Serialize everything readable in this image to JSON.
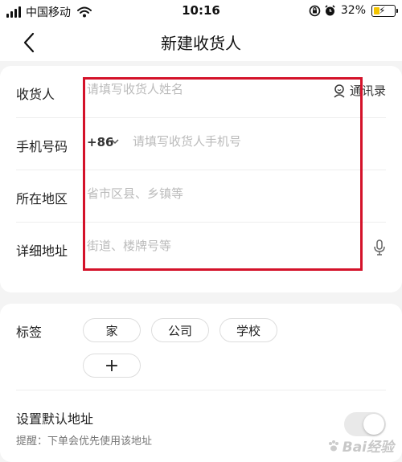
{
  "status_bar": {
    "carrier": "中国移动",
    "time": "10:16",
    "battery_percent": "32%",
    "battery_level": 0.32,
    "icons": [
      "signal-icon",
      "wifi-icon",
      "screen-lock-icon",
      "alarm-icon",
      "battery-charging-icon"
    ]
  },
  "nav": {
    "title": "新建收货人",
    "back_icon": "chevron-left-icon"
  },
  "form": {
    "receiver_label": "收货人",
    "receiver_placeholder": "请填写收货人姓名",
    "contacts_label": "通讯录",
    "phone_label": "手机号码",
    "country_code": "+86",
    "phone_placeholder": "请填写收货人手机号",
    "region_label": "所在地区",
    "region_placeholder": "省市区县、乡镇等",
    "address_label": "详细地址",
    "address_placeholder": "街道、楼牌号等"
  },
  "tags": {
    "label": "标签",
    "options": [
      "家",
      "公司",
      "学校"
    ],
    "add_symbol": "+"
  },
  "default_address": {
    "title": "设置默认地址",
    "hint": "提醒：下单会优先使用该地址",
    "enabled": false
  },
  "watermark": "Bai经验",
  "colors": {
    "highlight": "#d4122a",
    "battery": "#f3c400"
  }
}
